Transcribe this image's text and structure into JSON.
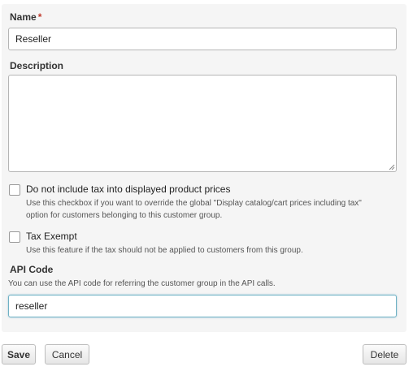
{
  "form": {
    "name": {
      "label": "Name",
      "required_marker": "*",
      "value": "Reseller"
    },
    "description": {
      "label": "Description",
      "value": ""
    },
    "tax_display": {
      "label": "Do not include tax into displayed product prices",
      "checked": false,
      "help_line1": "Use this checkbox if you want to override the global \"Display catalog/cart prices including tax\"",
      "help_line2": "option for customers belonging to this customer group."
    },
    "tax_exempt": {
      "label": "Tax Exempt",
      "checked": false,
      "help": "Use this feature if the tax should not be applied to customers from this group."
    },
    "api_code": {
      "label": "API Code",
      "help": "You can use the API code for referring the customer group in the API calls.",
      "value": "reseller"
    }
  },
  "actions": {
    "save_label": "Save",
    "cancel_label": "Cancel",
    "delete_label": "Delete"
  },
  "colors": {
    "panel_background": "#f5f5f5",
    "required_marker": "#c0392b",
    "focused_border": "#6fb1c4"
  }
}
